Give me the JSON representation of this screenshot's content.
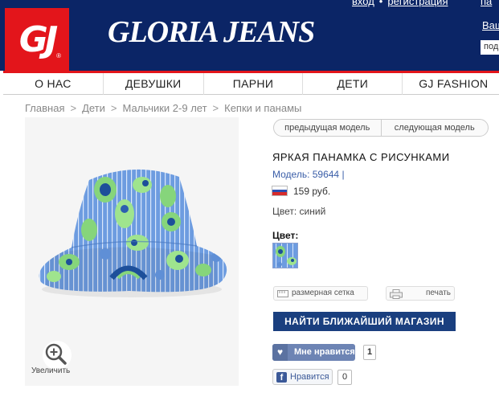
{
  "header": {
    "login_label": "вход",
    "register_label": "регистрация",
    "extra_top_link": "па",
    "logo_text": "GJ",
    "logo_reg": "®",
    "brand_text": "GLORIA JEANS",
    "right_link": "Ваш",
    "right_input_value": "под"
  },
  "nav": {
    "items": [
      "О НАС",
      "ДЕВУШКИ",
      "ПАРНИ",
      "ДЕТИ",
      "GJ FASHION"
    ]
  },
  "breadcrumb": [
    "Главная",
    "Дети",
    "Мальчики 2-9 лет",
    "Кепки и панамы"
  ],
  "breadcrumb_sep": ">",
  "product": {
    "prev_label": "предыдущая модель",
    "next_label": "следующая модель",
    "title": "ЯРКАЯ ПАНАМКА С РИСУНКАМИ",
    "model": "Модель: 59644  |",
    "price": "159 руб.",
    "color_line": "Цвет: синий",
    "color_heading": "Цвет:",
    "zoom_label": "Увеличить",
    "size_chart_label": "размерная сетка",
    "print_label": "печать",
    "find_store_label": "НАЙТИ БЛИЖАЙШИЙ МАГАЗИН",
    "like_label": "Мне нравится",
    "like_count": "1",
    "fb_label": "Нравится",
    "fb_count": "0"
  },
  "colors": {
    "header_bg": "#0b2566",
    "logo_red": "#e3151b",
    "find_store_bg": "#1a3f7f",
    "like_bg": "#6d84b4",
    "hat_blue": "#6d9ce0",
    "hat_green": "#86d57b"
  },
  "icons": [
    "magnifier-plus-icon",
    "ruler-icon",
    "printer-icon",
    "heart-icon",
    "facebook-icon",
    "russia-flag-icon"
  ]
}
